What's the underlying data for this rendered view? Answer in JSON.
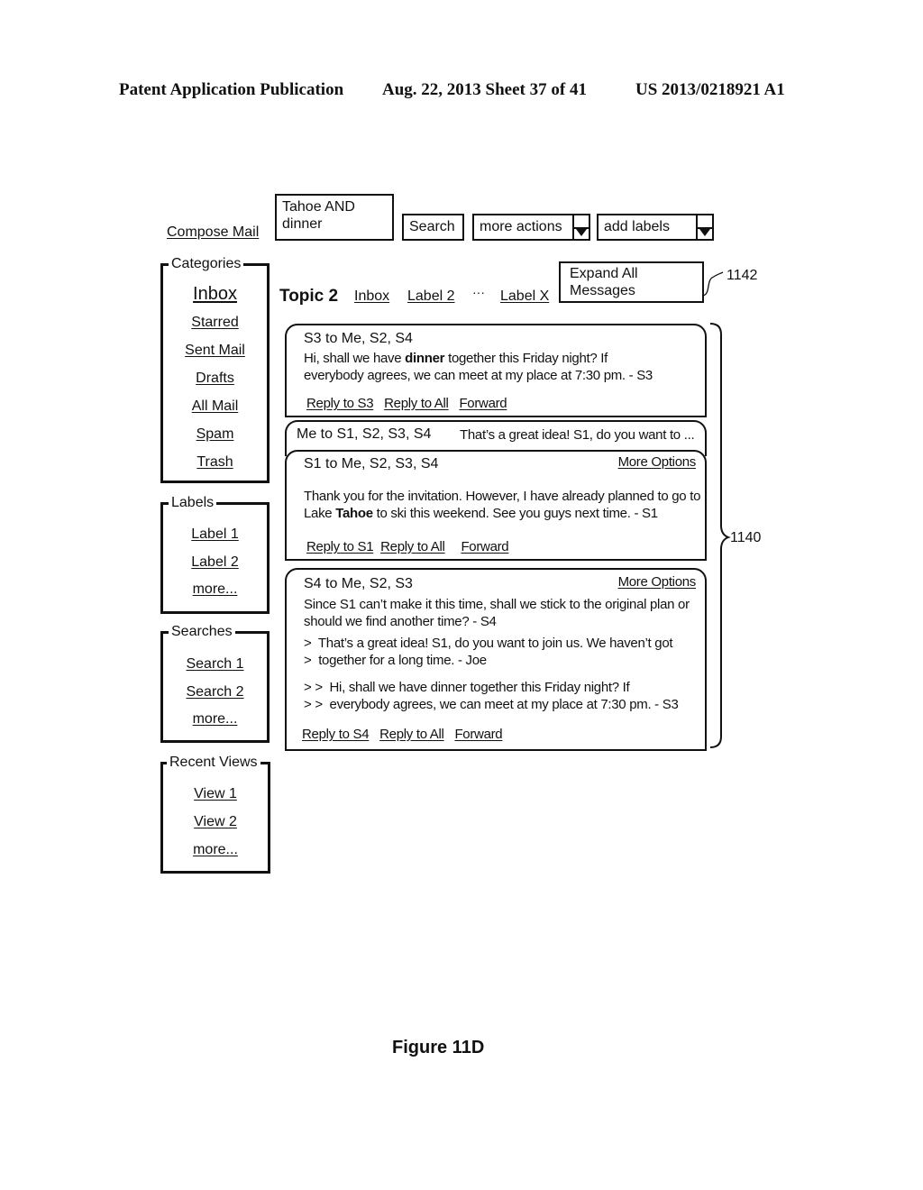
{
  "patent_header": {
    "left": "Patent Application Publication",
    "center": "Aug. 22, 2013  Sheet 37 of 41",
    "right": "US 2013/0218921 A1"
  },
  "toolbar": {
    "compose_label": "Compose Mail",
    "search_query": "Tahoe AND dinner",
    "search_button": "Search",
    "more_actions": "more actions",
    "add_labels": "add labels"
  },
  "sidebar": {
    "categories": {
      "title": "Categories",
      "items": [
        "Inbox",
        "Starred",
        "Sent Mail",
        "Drafts",
        "All Mail",
        "Spam",
        "Trash"
      ]
    },
    "labels": {
      "title": "Labels",
      "items": [
        "Label 1",
        "Label 2",
        "more..."
      ]
    },
    "searches": {
      "title": "Searches",
      "items": [
        "Search 1",
        "Search 2",
        "more..."
      ]
    },
    "recent_views": {
      "title": "Recent Views",
      "items": [
        "View 1",
        "View 2",
        "more..."
      ]
    }
  },
  "topic": {
    "title": "Topic 2",
    "labels": [
      "Inbox",
      "Label 2",
      "···",
      "Label X"
    ],
    "expand_button": "Expand All Messages",
    "ref_expand": "1142",
    "ref_thread": "1140"
  },
  "messages": [
    {
      "header": "S3 to Me, S2, S4",
      "body_pre": "Hi, shall we have ",
      "body_bold": "dinner",
      "body_post": " together this Friday night? If",
      "body_line2": "everybody agrees, we can meet at my place at 7:30 pm. - S3",
      "links": [
        "Reply to S3",
        "Reply to All",
        "Forward"
      ]
    },
    {
      "header": "Me to S1, S2, S3, S4",
      "snippet": "That’s a great idea! S1, do you want to ..."
    },
    {
      "header": "S1 to Me, S2, S3, S4",
      "more_options": "More Options",
      "body_line1": "Thank you for the invitation. However, I have already planned to go to",
      "body_pre": "Lake ",
      "body_bold": "Tahoe",
      "body_post": " to ski this weekend. See you guys next time. - S1",
      "links": [
        "Reply to S1",
        "Reply to All",
        "Forward"
      ]
    },
    {
      "header": "S4 to Me, S2, S3",
      "more_options": "More Options",
      "body_line1": "Since S1 can’t make it this time, shall we stick to the original plan or",
      "body_line2": "should we find another time? - S4",
      "quote1_line1": ">  That’s a great idea! S1, do you want to join us. We haven’t got",
      "quote1_line2": ">  together for a long time. - Joe",
      "quote2_line1": "> >  Hi, shall we have dinner together this Friday night? If",
      "quote2_line2": "> >  everybody agrees, we can meet at my place at 7:30 pm. - S3",
      "links": [
        "Reply to S4",
        "Reply to All",
        "Forward"
      ]
    }
  ],
  "figure_caption": "Figure 11D"
}
